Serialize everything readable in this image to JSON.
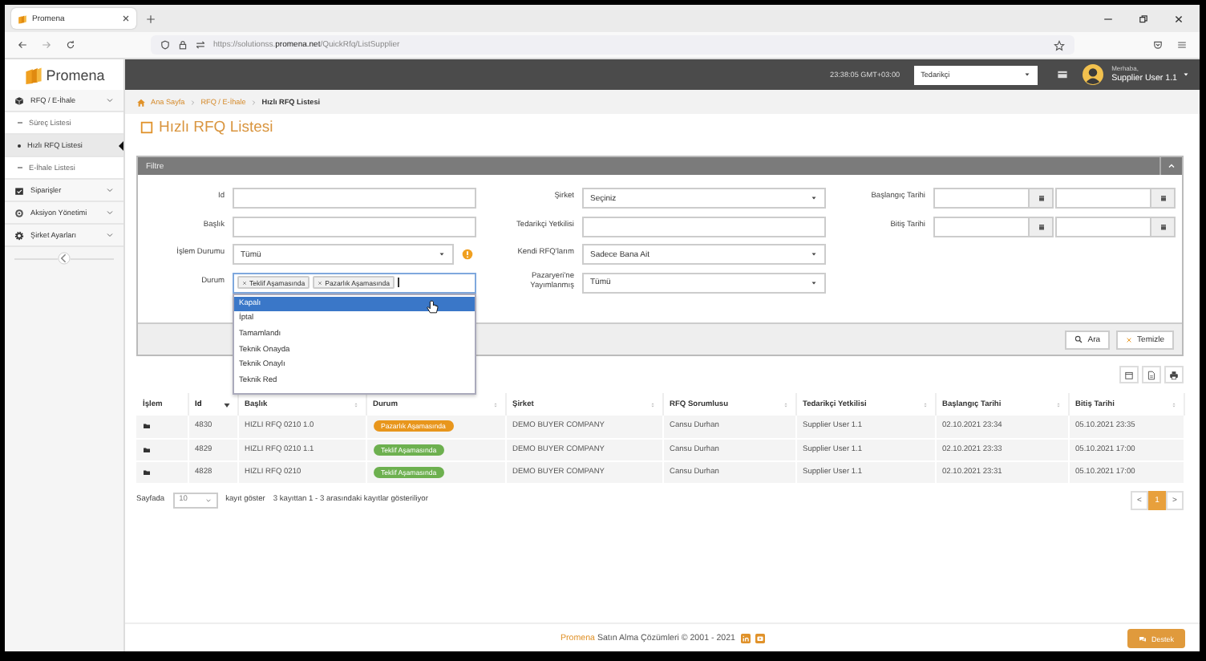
{
  "browser": {
    "tab_title": "Promena",
    "url": {
      "prefix": "https://solutionss.",
      "domain": "promena.net",
      "path": "/QuickRfq/ListSupplier"
    }
  },
  "sidebar": {
    "logo": "Promena",
    "items": [
      {
        "label": "RFQ / E-İhale",
        "children": [
          {
            "label": "Süreç Listesi",
            "selected": false
          },
          {
            "label": "Hızlı RFQ Listesi",
            "selected": true
          },
          {
            "label": "E-İhale Listesi",
            "selected": false
          }
        ]
      },
      {
        "label": "Siparişler"
      },
      {
        "label": "Aksiyon Yönetimi"
      },
      {
        "label": "Şirket Ayarları"
      }
    ]
  },
  "header": {
    "time": "23:38:05 GMT+03:00",
    "role": "Tedarikçi",
    "greeting": "Merhaba,",
    "user": "Supplier User 1.1"
  },
  "breadcrumb": [
    "Ana Sayfa",
    "RFQ / E-İhale",
    "Hızlı RFQ Listesi"
  ],
  "page_title": "Hızlı RFQ Listesi",
  "filter": {
    "title": "Filtre",
    "columns": [
      [
        {
          "label": "Id",
          "kind": "text"
        },
        {
          "label": "Başlık",
          "kind": "text"
        },
        {
          "label": "İşlem Durumu",
          "kind": "select",
          "value": "Tümü",
          "has_info": true
        },
        {
          "label": "Durum",
          "kind": "multiselect",
          "tags": [
            "Teklif Aşamasında",
            "Pazarlık Aşamasında"
          ],
          "options": [
            {
              "label": "Kapalı",
              "selected": true
            },
            {
              "label": "İptal",
              "selected": false
            },
            {
              "label": "Tamamlandı",
              "selected": false
            },
            {
              "label": "Teknik Onayda",
              "selected": false
            },
            {
              "label": "Teknik Onaylı",
              "selected": false
            },
            {
              "label": "Teknik Red",
              "selected": false
            }
          ]
        }
      ],
      [
        {
          "label": "Şirket",
          "kind": "select",
          "value": "Seçiniz"
        },
        {
          "label": "Tedarikçi Yetkilisi",
          "kind": "text"
        },
        {
          "label": "Kendi RFQ'larım",
          "kind": "select",
          "value": "Sadece Bana Ait"
        },
        {
          "label": "Pazaryeri'ne Yayımlanmış",
          "kind": "select",
          "value": "Tümü"
        }
      ],
      [
        {
          "label": "Başlangıç Tarihi",
          "kind": "daterange"
        },
        {
          "label": "Bitiş Tarihi",
          "kind": "daterange"
        }
      ]
    ],
    "buttons": [
      {
        "label": "Ara",
        "kind": "search"
      },
      {
        "label": "Temizle",
        "kind": "clear"
      }
    ]
  },
  "table": {
    "columns": [
      {
        "label": "İşlem",
        "sortable": false,
        "sorted": false
      },
      {
        "label": "Id",
        "sortable": true,
        "sorted": true
      },
      {
        "label": "Başlık",
        "sortable": true,
        "sorted": false
      },
      {
        "label": "Durum",
        "sortable": true,
        "sorted": false
      },
      {
        "label": "Şirket",
        "sortable": true,
        "sorted": false
      },
      {
        "label": "RFQ Sorumlusu",
        "sortable": true,
        "sorted": false
      },
      {
        "label": "Tedarikçi Yetkilisi",
        "sortable": true,
        "sorted": false
      },
      {
        "label": "Başlangıç Tarihi",
        "sortable": true,
        "sorted": false
      },
      {
        "label": "Bitiş Tarihi",
        "sortable": true,
        "sorted": false
      }
    ],
    "rows": [
      {
        "id": "4830",
        "title": "HIZLI RFQ 0210 1.0",
        "status": "Pazarlık Aşamasında",
        "color": "#e8961c",
        "company": "DEMO BUYER COMPANY",
        "owner": "Cansu Durhan",
        "supplier": "Supplier User 1.1",
        "start": "02.10.2021 23:34",
        "end": "05.10.2021 23:35"
      },
      {
        "id": "4829",
        "title": "HIZLI RFQ 0210 1.1",
        "status": "Teklif Aşamasında",
        "color": "#6db04f",
        "company": "DEMO BUYER COMPANY",
        "owner": "Cansu Durhan",
        "supplier": "Supplier User 1.1",
        "start": "02.10.2021 23:33",
        "end": "05.10.2021 17:00"
      },
      {
        "id": "4828",
        "title": "HIZLI RFQ 0210",
        "status": "Teklif Aşamasında",
        "color": "#6db04f",
        "company": "DEMO BUYER COMPANY",
        "owner": "Cansu Durhan",
        "supplier": "Supplier User 1.1",
        "start": "02.10.2021 23:31",
        "end": "05.10.2021 17:00"
      }
    ]
  },
  "pagination": {
    "prefix": "Sayfada",
    "page_size": "10",
    "suffix": "kayıt göster",
    "info": "3 kayıttan 1 - 3 arasındaki kayıtlar gösteriliyor",
    "prev": "<",
    "next": ">",
    "pages": [
      {
        "label": "1",
        "selected": true
      }
    ]
  },
  "footer": {
    "brand": "Promena",
    "text": "Satın Alma Çözümleri © 2001 - 2021",
    "support": "Destek"
  }
}
